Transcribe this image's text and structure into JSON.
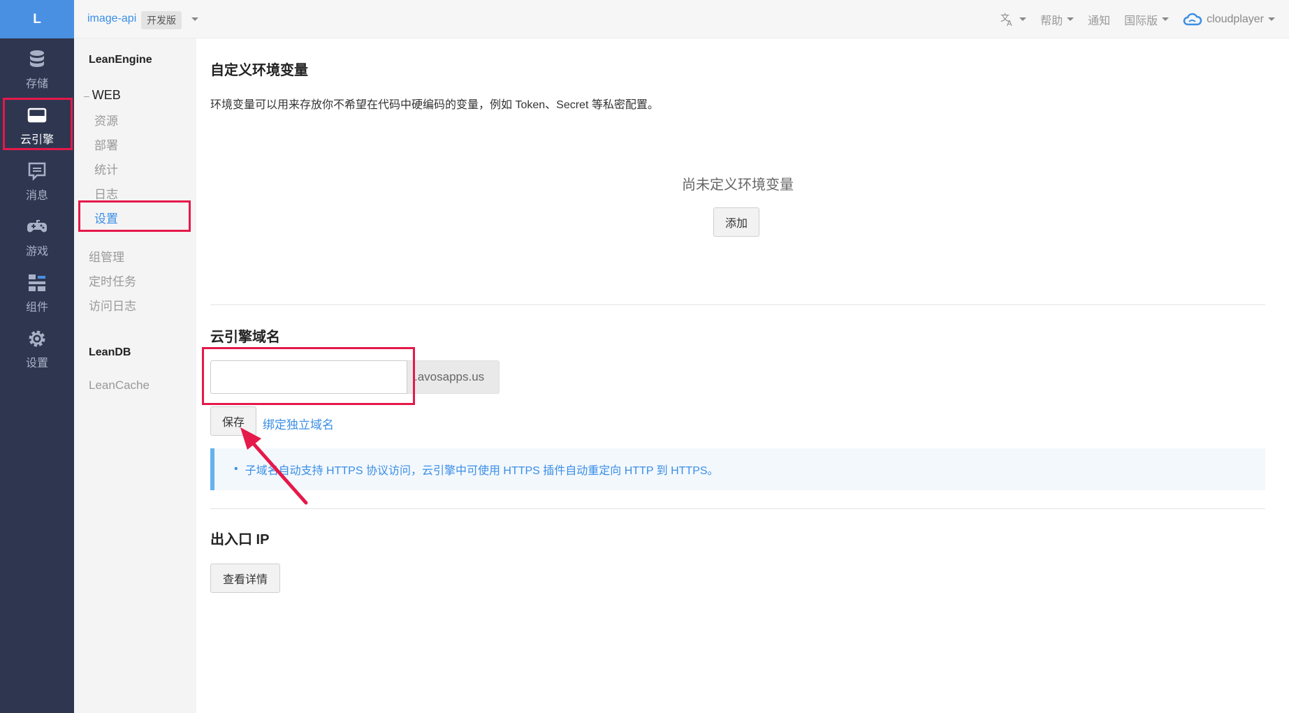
{
  "rail": {
    "logo": "L",
    "items": [
      {
        "id": "storage",
        "label": "存储",
        "icon": "database-icon"
      },
      {
        "id": "engine",
        "label": "云引擎",
        "icon": "engine-icon",
        "active": true
      },
      {
        "id": "message",
        "label": "消息",
        "icon": "message-icon"
      },
      {
        "id": "game",
        "label": "游戏",
        "icon": "gamepad-icon"
      },
      {
        "id": "component",
        "label": "组件",
        "icon": "component-icon"
      },
      {
        "id": "settings",
        "label": "设置",
        "icon": "gear-icon"
      }
    ]
  },
  "topbar": {
    "app_name": "image-api",
    "app_badge": "开发版",
    "help": "帮助",
    "notify": "通知",
    "region": "国际版",
    "user": "cloudplayer"
  },
  "subnav": {
    "section1": "LeanEngine",
    "group_web": "WEB",
    "web_items": [
      "资源",
      "部署",
      "统计",
      "日志",
      "设置"
    ],
    "others": [
      "组管理",
      "定时任务",
      "访问日志"
    ],
    "section2": "LeanDB",
    "leancache": "LeanCache"
  },
  "main": {
    "env_title": "自定义环境变量",
    "env_desc": "环境变量可以用来存放你不希望在代码中硬编码的变量，例如 Token、Secret 等私密配置。",
    "env_empty": "尚未定义环境变量",
    "env_add": "添加",
    "domain_title": "云引擎域名",
    "domain_value": "",
    "domain_suffix": ".avosapps.us",
    "save": "保存",
    "bind_domain": "绑定独立域名",
    "info": "子域名自动支持 HTTPS 协议访问，云引擎中可使用 HTTPS 插件自动重定向 HTTP 到 HTTPS。",
    "ip_title": "出入口 IP",
    "ip_details": "查看详情"
  },
  "colors": {
    "rail_bg": "#2f3650",
    "accent": "#3a8ee6",
    "highlight": "#e5194a"
  }
}
